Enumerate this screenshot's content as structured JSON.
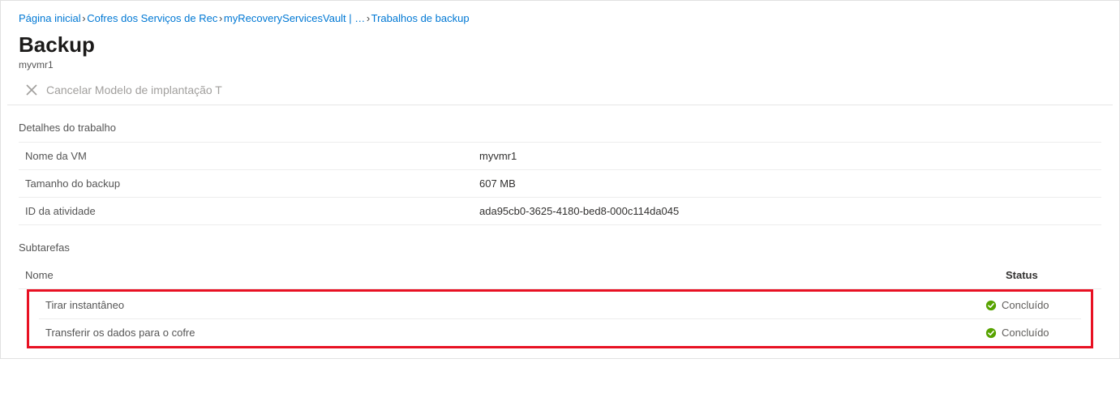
{
  "breadcrumb": {
    "items": [
      "Página inicial",
      "Cofres dos Serviços de Rec",
      "myRecoveryServicesVault | …",
      "Trabalhos de backup"
    ]
  },
  "header": {
    "title": "Backup",
    "subtitle": "myvmr1"
  },
  "toolbar": {
    "cancel_label": "Cancelar Modelo de implantação T"
  },
  "details": {
    "section_label": "Detalhes do trabalho",
    "rows": [
      {
        "label": "Nome da VM",
        "value": "myvmr1"
      },
      {
        "label": "Tamanho do backup",
        "value": "607 MB"
      },
      {
        "label": "ID da atividade",
        "value": "ada95cb0-3625-4180-bed8-000c114da045"
      }
    ]
  },
  "subtasks": {
    "section_label": "Subtarefas",
    "columns": {
      "name": "Nome",
      "status": "Status"
    },
    "rows": [
      {
        "name": "Tirar instantâneo",
        "status": "Concluído"
      },
      {
        "name": "Transferir os dados para o cofre",
        "status": "Concluído"
      }
    ]
  },
  "colors": {
    "success": "#57a300"
  }
}
